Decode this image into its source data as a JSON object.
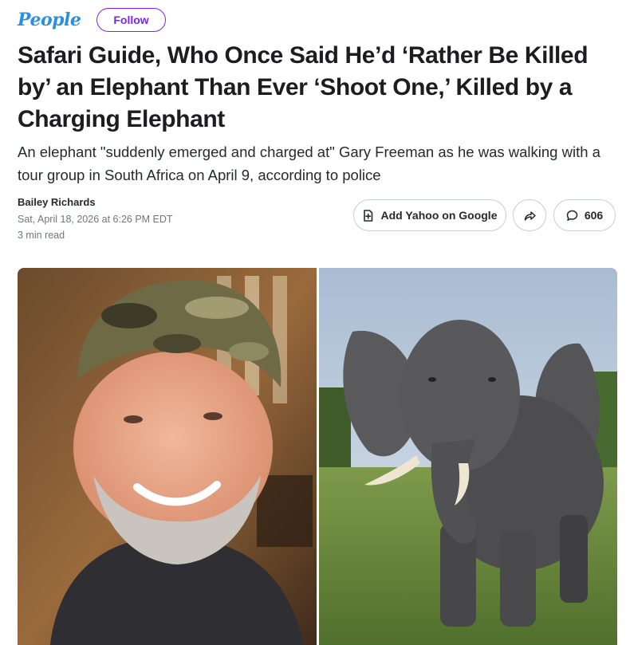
{
  "brand": {
    "logo_text": "People",
    "follow_label": "Follow",
    "logo_color": "#2b8fe0",
    "accent_color": "#7e1fff"
  },
  "article": {
    "headline": "Safari Guide, Who Once Said He’d ‘Rather Be Killed by’ an Elephant Than Ever ‘Shoot One,’ Killed by a Charging Elephant",
    "subheadline": "An elephant \"suddenly emerged and charged at\" Gary Freeman as he was walking with a tour group in South Africa on April 9, according to police",
    "author": "Bailey Richards",
    "date": "Sat, April 18, 2026 at 6:26 PM EDT",
    "read_time": "3 min read"
  },
  "actions": {
    "add_google_label": "Add Yahoo on Google",
    "comment_count": "606",
    "icons": [
      "add-source-icon",
      "share-icon",
      "comment-icon"
    ]
  },
  "images": {
    "left": "man-in-camo-cap-photo",
    "right": "elephant-photo"
  }
}
